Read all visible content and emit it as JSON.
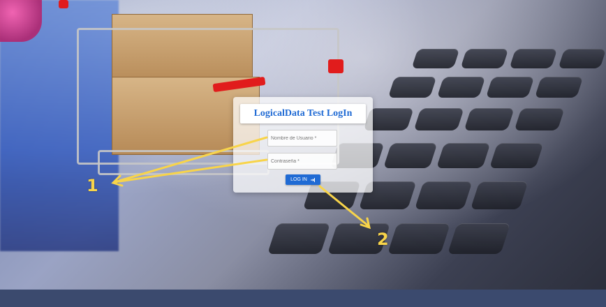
{
  "login": {
    "title": "LogicalData Test LogIn",
    "username_placeholder": "Nombre de Usuario *",
    "password_placeholder": "Contraseña *",
    "login_button_label": "LOG IN",
    "login_icon": "login-arrow-icon",
    "accent_color": "#1f6ad4"
  },
  "annotations": {
    "marker_1": "1",
    "marker_2": "2",
    "color": "#f8d44a"
  }
}
